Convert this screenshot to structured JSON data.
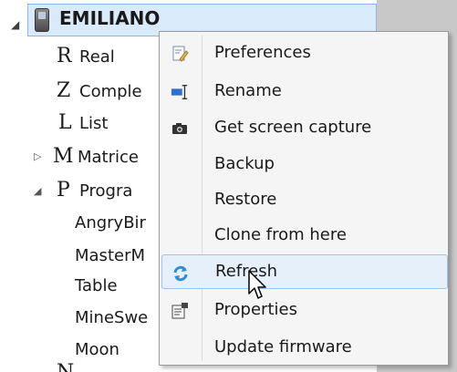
{
  "tree": {
    "root_label": "EMILIANO",
    "items": [
      {
        "letter": "R",
        "label": "Real",
        "expander": ""
      },
      {
        "letter": "Z",
        "label": "Comple",
        "expander": ""
      },
      {
        "letter": "L",
        "label": "List",
        "expander": ""
      },
      {
        "letter": "M",
        "label": "Matrice",
        "expander": "▷"
      },
      {
        "letter": "P",
        "label": "Progra",
        "expander": "◢"
      }
    ],
    "programs": [
      "AngryBir",
      "MasterM",
      "Table",
      "MineSwe",
      "Moon"
    ],
    "partial_next_letter": "N"
  },
  "menu": {
    "items": [
      {
        "label": "Preferences",
        "icon": "preferences-icon"
      },
      {
        "label": "Rename",
        "icon": "rename-icon"
      },
      {
        "label": "Get screen capture",
        "icon": "camera-icon"
      },
      {
        "label": "Backup",
        "icon": ""
      },
      {
        "label": "Restore",
        "icon": ""
      },
      {
        "label": "Clone from here",
        "icon": ""
      },
      {
        "label": "Refresh",
        "icon": "refresh-icon",
        "highlighted": true
      },
      {
        "label": "Properties",
        "icon": "properties-icon"
      },
      {
        "label": "Update firmware",
        "icon": ""
      }
    ]
  },
  "colors": {
    "selection": "#d9ebfb",
    "menu_bg": "#f5f5f5",
    "hover": "#e5f0fb",
    "refresh_icon": "#2f8fd0"
  }
}
